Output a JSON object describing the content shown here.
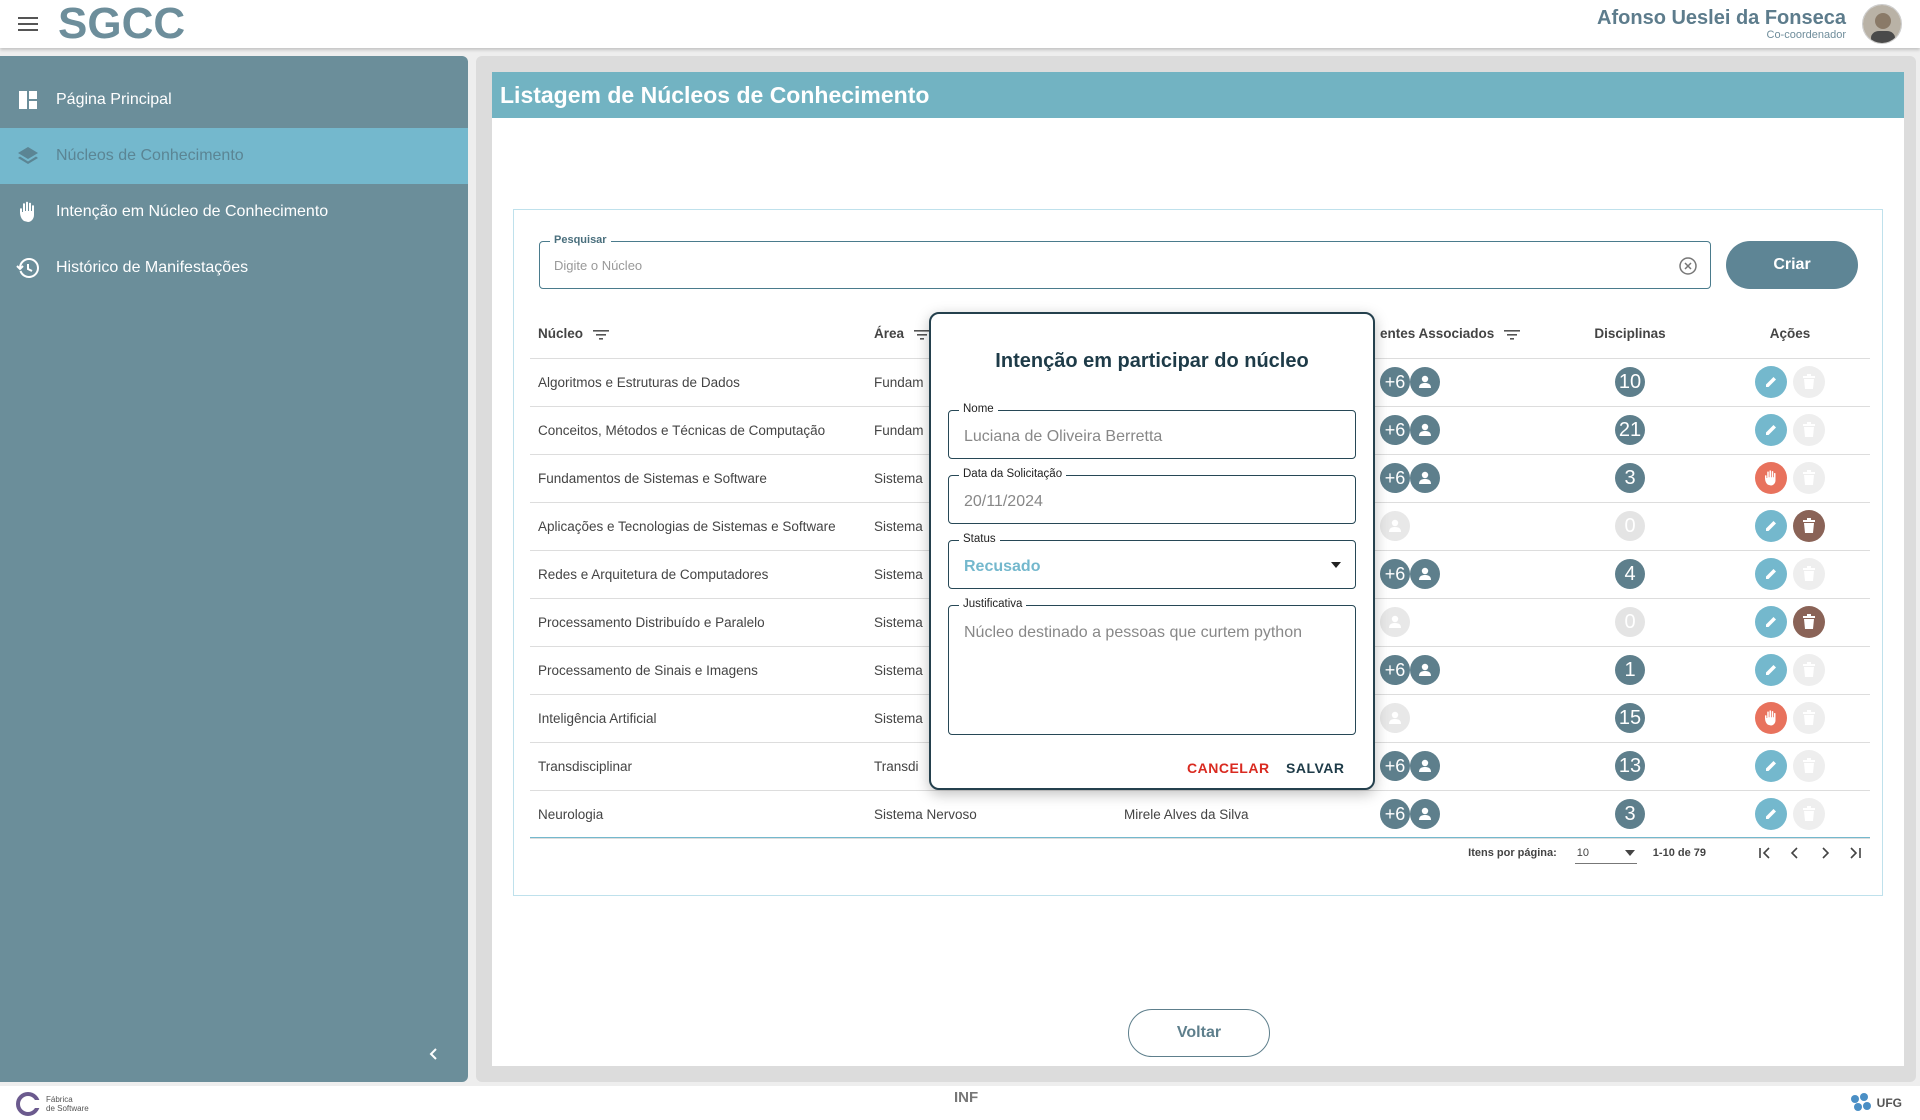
{
  "header": {
    "logo_text": "SGCC",
    "user_name": "Afonso Ueslei da Fonseca",
    "user_role": "Co-coordenador"
  },
  "sidebar": {
    "items": [
      {
        "label": "Página Principal",
        "icon": "dashboard-icon"
      },
      {
        "label": "Núcleos de Conhecimento",
        "icon": "layers-icon",
        "active": true
      },
      {
        "label": "Intenção em Núcleo de Conhecimento",
        "icon": "hand-icon"
      },
      {
        "label": "Histórico de Manifestações",
        "icon": "history-icon"
      }
    ]
  },
  "page": {
    "title": "Listagem de Núcleos de Conhecimento",
    "search_label": "Pesquisar",
    "search_placeholder": "Digite o Núcleo",
    "create_label": "Criar",
    "back_label": "Voltar"
  },
  "table": {
    "headers": {
      "nucleo": "Núcleo",
      "area": "Área",
      "docentes": "entes Associados",
      "disciplinas": "Disciplinas",
      "acoes": "Ações"
    },
    "rows": [
      {
        "nucleo": "Algoritmos e Estruturas de Dados",
        "area": "Fundam",
        "coord": "",
        "docentes": "+6",
        "disciplinas": "10",
        "action": "edit",
        "delete_enabled": false
      },
      {
        "nucleo": "Conceitos, Métodos e Técnicas de Computação",
        "area": "Fundam",
        "coord": "",
        "docentes": "+6",
        "disciplinas": "21",
        "action": "edit",
        "delete_enabled": false
      },
      {
        "nucleo": "Fundamentos de Sistemas e Software",
        "area": "Sistema",
        "coord": "",
        "docentes": "+6",
        "disciplinas": "3",
        "action": "hand",
        "delete_enabled": false
      },
      {
        "nucleo": "Aplicações e Tecnologias de Sistemas e Software",
        "area": "Sistema",
        "coord": "",
        "docentes": "",
        "disciplinas": "0",
        "action": "edit",
        "delete_enabled": true
      },
      {
        "nucleo": "Redes e Arquitetura de Computadores",
        "area": "Sistema",
        "coord": "",
        "docentes": "+6",
        "disciplinas": "4",
        "action": "edit",
        "delete_enabled": false
      },
      {
        "nucleo": "Processamento Distribuído e Paralelo",
        "area": "Sistema",
        "coord": "",
        "docentes": "",
        "disciplinas": "0",
        "action": "edit",
        "delete_enabled": true
      },
      {
        "nucleo": "Processamento de Sinais e Imagens",
        "area": "Sistema",
        "coord": "",
        "docentes": "+6",
        "disciplinas": "1",
        "action": "edit",
        "delete_enabled": false
      },
      {
        "nucleo": "Inteligência Artificial",
        "area": "Sistema",
        "coord": "",
        "docentes": "",
        "disciplinas": "15",
        "action": "hand",
        "delete_enabled": false
      },
      {
        "nucleo": "Transdisciplinar",
        "area": "Transdi",
        "coord": "",
        "docentes": "+6",
        "disciplinas": "13",
        "action": "edit",
        "delete_enabled": false
      },
      {
        "nucleo": "Neurologia",
        "area": "Sistema Nervoso",
        "coord": "Mirele Alves da Silva",
        "docentes": "+6",
        "disciplinas": "3",
        "action": "edit",
        "delete_enabled": false
      }
    ]
  },
  "pagination": {
    "items_per_page_label": "Itens por página:",
    "items_per_page": "10",
    "range": "1-10 de 79"
  },
  "dialog": {
    "title": "Intenção em participar do núcleo",
    "nome_label": "Nome",
    "nome_value": "Luciana de Oliveira Berretta",
    "data_label": "Data da Solicitação",
    "data_value": "20/11/2024",
    "status_label": "Status",
    "status_value": "Recusado",
    "just_label": "Justificativa",
    "just_value": "Núcleo destinado a pessoas que curtem python",
    "cancel_label": "CANCELAR",
    "save_label": "SALVAR"
  },
  "footer": {
    "fabrica_line1": "Fábrica",
    "fabrica_line2": "de Software",
    "inf_text": "INF",
    "ufg_text": "UFG"
  },
  "colors": {
    "sidebar": "#6b8e9a",
    "accent": "#74b8cd",
    "dark": "#5e7f8c",
    "danger": "#e8725d"
  }
}
